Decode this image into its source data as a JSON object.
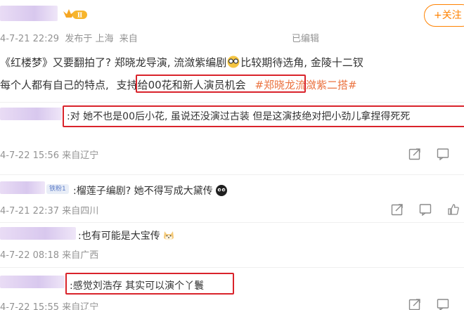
{
  "post": {
    "vip_badge": "Ⅱ",
    "follow_label": "+关注",
    "timestamp": "4-7-21 22:29",
    "source": "发布于 上海",
    "client": "来自",
    "edited": "已编辑",
    "line1_a": "《红楼梦》又要翻拍了? 郑晓龙导演, 流潋紫编剧",
    "line1_b": "比较期待选角, 金陵十二钗",
    "line2_a": "每个人都有自己的特点,",
    "line2_highlight": "支持给00花和新人演员机会",
    "line2_topic": "#郑晓龙流潋紫二搭#"
  },
  "comments": [
    {
      "text": ":对 她不也是00后小花, 虽说还没演过古装 但是这演技绝对把小劲儿拿捏得死死",
      "time": "4-7-22 15:56 来自辽宁"
    },
    {
      "fan_badge": "铁粉1",
      "text": ":榴莲子编剧? 她不得写成大黛传",
      "time": "4-7-21 22:37 来自四川"
    },
    {
      "text": ":也有可能是大宝传",
      "time": "4-7-22 08:18 来自广西"
    },
    {
      "text": ":感觉刘浩存 其实可以演个丫鬟",
      "time": "4-7-22 15:55 来自辽宁"
    }
  ],
  "icons": [
    "vip-crown-icon",
    "glasses-emoji-icon",
    "share-icon",
    "comment-icon",
    "like-icon",
    "black-creature-emoji-icon",
    "shiba-dog-emoji-icon"
  ],
  "colors": {
    "accent": "#ff8200",
    "topic": "#eb7340",
    "highlight_box": "#d9232b",
    "meta": "#939393"
  }
}
